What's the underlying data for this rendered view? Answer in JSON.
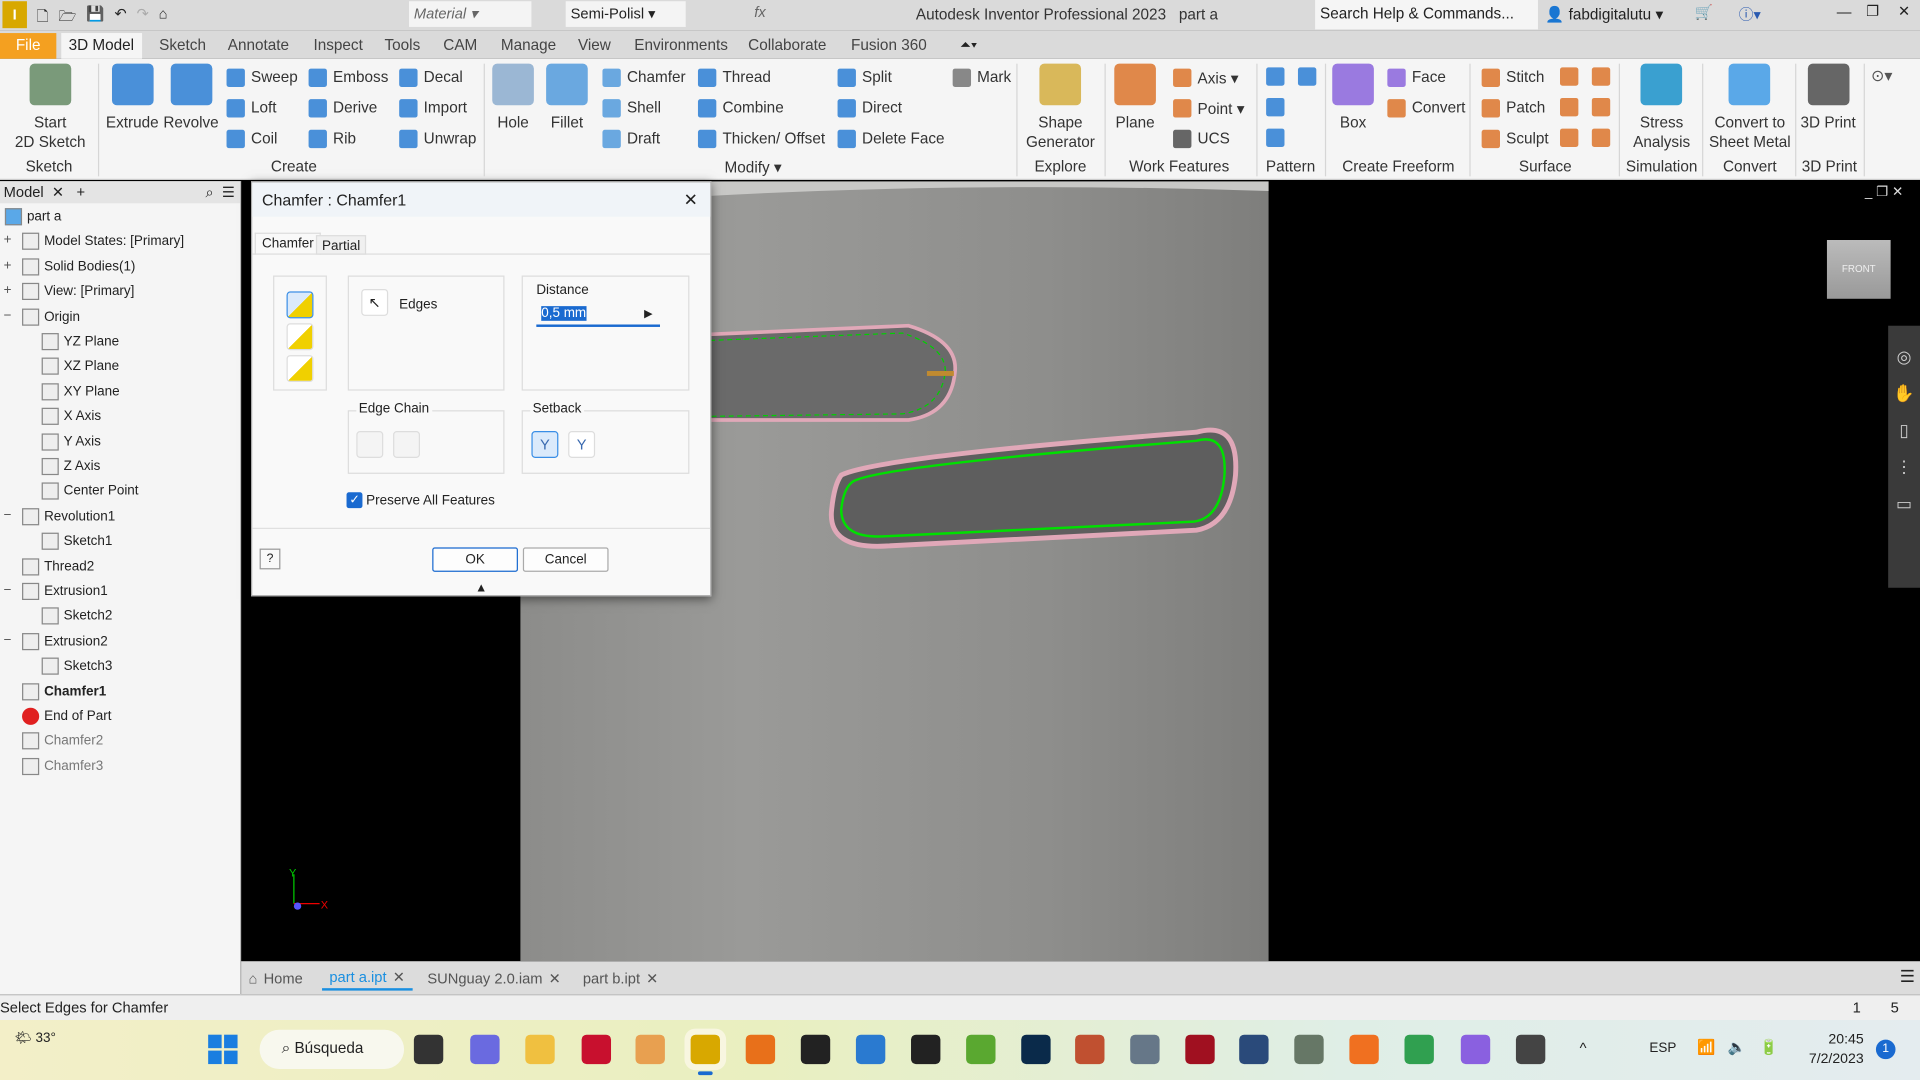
{
  "app": {
    "title": "Autodesk Inventor Professional 2023",
    "document": "part a",
    "search_placeholder": "Search Help & Commands...",
    "user": "fabdigitalutu",
    "material": "Material",
    "appearance": "Semi-Polisl"
  },
  "ribbon_tabs": [
    "File",
    "3D Model",
    "Sketch",
    "Annotate",
    "Inspect",
    "Tools",
    "CAM",
    "Manage",
    "View",
    "Environments",
    "Collaborate",
    "Fusion 360"
  ],
  "ribbon_groups": [
    "Sketch",
    "Create",
    "Modify ▾",
    "Explore",
    "Work Features",
    "Pattern",
    "Create Freeform",
    "Surface",
    "Simulation",
    "Convert",
    "3D Print"
  ],
  "ribbon_large": [
    {
      "label": "Start\n2D Sketch",
      "color": "#7a9a7a"
    },
    {
      "label": "Extrude",
      "color": "#4a90d9"
    },
    {
      "label": "Revolve",
      "color": "#4a90d9"
    },
    {
      "label": "Hole",
      "color": "#9bb7d4"
    },
    {
      "label": "Fillet",
      "color": "#6aa8e0"
    },
    {
      "label": "Shape\nGenerator",
      "color": "#d9b85a"
    },
    {
      "label": "Plane",
      "color": "#e0884a"
    },
    {
      "label": "Box",
      "color": "#9a7ae0"
    },
    {
      "label": "Stress\nAnalysis",
      "color": "#3aa0d0"
    },
    {
      "label": "Convert to\nSheet Metal",
      "color": "#5aa8e8"
    },
    {
      "label": "3D Print",
      "color": "#666666"
    }
  ],
  "ribbon_small": [
    {
      "label": "Sweep",
      "color": "#4a90d9"
    },
    {
      "label": "Loft",
      "color": "#4a90d9"
    },
    {
      "label": "Coil",
      "color": "#4a90d9"
    },
    {
      "label": "Emboss",
      "color": "#4a90d9"
    },
    {
      "label": "Derive",
      "color": "#4a90d9"
    },
    {
      "label": "Rib",
      "color": "#4a90d9"
    },
    {
      "label": "Decal",
      "color": "#4a90d9"
    },
    {
      "label": "Import",
      "color": "#4a90d9"
    },
    {
      "label": "Unwrap",
      "color": "#4a90d9"
    },
    {
      "label": "Chamfer",
      "color": "#6aa8e0"
    },
    {
      "label": "Shell",
      "color": "#6aa8e0"
    },
    {
      "label": "Draft",
      "color": "#6aa8e0"
    },
    {
      "label": "Thread",
      "color": "#4a90d9"
    },
    {
      "label": "Combine",
      "color": "#4a90d9"
    },
    {
      "label": "Thicken/ Offset",
      "color": "#4a90d9"
    },
    {
      "label": "Split",
      "color": "#4a90d9"
    },
    {
      "label": "Direct",
      "color": "#4a90d9"
    },
    {
      "label": "Delete Face",
      "color": "#4a90d9"
    },
    {
      "label": "Mark",
      "color": "#888888"
    },
    {
      "label": "Axis ▾",
      "color": "#e0884a"
    },
    {
      "label": "Point ▾",
      "color": "#e0884a"
    },
    {
      "label": "UCS",
      "color": "#666666"
    },
    {
      "label": "Face",
      "color": "#9a7ae0"
    },
    {
      "label": "Convert",
      "color": "#e0884a"
    },
    {
      "label": "Stitch",
      "color": "#e0884a"
    },
    {
      "label": "Patch",
      "color": "#e0884a"
    },
    {
      "label": "Sculpt",
      "color": "#e0884a"
    }
  ],
  "browser": {
    "tab": "Model",
    "items": [
      {
        "label": "part a",
        "lvl": 0
      },
      {
        "label": "Model States: [Primary]",
        "lvl": 1,
        "pm": "+"
      },
      {
        "label": "Solid Bodies(1)",
        "lvl": 1,
        "pm": "+"
      },
      {
        "label": "View: [Primary]",
        "lvl": 1,
        "pm": "+"
      },
      {
        "label": "Origin",
        "lvl": 1,
        "pm": "−"
      },
      {
        "label": "YZ Plane",
        "lvl": 2
      },
      {
        "label": "XZ Plane",
        "lvl": 2
      },
      {
        "label": "XY Plane",
        "lvl": 2
      },
      {
        "label": "X Axis",
        "lvl": 2
      },
      {
        "label": "Y Axis",
        "lvl": 2
      },
      {
        "label": "Z Axis",
        "lvl": 2
      },
      {
        "label": "Center Point",
        "lvl": 2
      },
      {
        "label": "Revolution1",
        "lvl": 1,
        "pm": "−"
      },
      {
        "label": "Sketch1",
        "lvl": 2
      },
      {
        "label": "Thread2",
        "lvl": 1
      },
      {
        "label": "Extrusion1",
        "lvl": 1,
        "pm": "−"
      },
      {
        "label": "Sketch2",
        "lvl": 2
      },
      {
        "label": "Extrusion2",
        "lvl": 1,
        "pm": "−"
      },
      {
        "label": "Sketch3",
        "lvl": 2
      },
      {
        "label": "Chamfer1",
        "lvl": 1,
        "style": "bold"
      },
      {
        "label": "End of Part",
        "lvl": 1,
        "icon": "error"
      },
      {
        "label": "Chamfer2",
        "lvl": 1,
        "style": "dim"
      },
      {
        "label": "Chamfer3",
        "lvl": 1,
        "style": "dim"
      }
    ]
  },
  "dialog": {
    "title": "Chamfer : Chamfer1",
    "tabs": [
      "Chamfer",
      "Partial"
    ],
    "edges_label": "Edges",
    "distance_label": "Distance",
    "distance_value": "0,5 mm",
    "edge_chain_label": "Edge Chain",
    "setback_label": "Setback",
    "preserve_label": "Preserve All Features",
    "preserve_checked": true,
    "ok": "OK",
    "cancel": "Cancel"
  },
  "viewcube": {
    "face": "FRONT"
  },
  "triad": {
    "x": "X",
    "y": "Y"
  },
  "doc_tabs": [
    {
      "label": "Home"
    },
    {
      "label": "part a.ipt",
      "active": true
    },
    {
      "label": "SUNguay 2.0.iam"
    },
    {
      "label": "part b.ipt"
    }
  ],
  "status": {
    "message": "Select Edges for Chamfer",
    "count1": "1",
    "count2": "5"
  },
  "taskbar": {
    "weather": "33°",
    "search": "Búsqueda",
    "lang": "ESP",
    "time": "20:45",
    "date": "7/2/2023",
    "badge": "1",
    "apps": [
      {
        "color": "#333333"
      },
      {
        "color": "#6a6ae0"
      },
      {
        "color": "#f0c040"
      },
      {
        "color": "#c8102e"
      },
      {
        "color": "#e8a050"
      },
      {
        "color": "#d8a800",
        "active": true
      },
      {
        "color": "#e8701a"
      },
      {
        "color": "#222222"
      },
      {
        "color": "#2a7ad0"
      },
      {
        "color": "#222222"
      },
      {
        "color": "#5aa830"
      },
      {
        "color": "#0a2a4a"
      },
      {
        "color": "#c05030"
      },
      {
        "color": "#667788"
      },
      {
        "color": "#a01020"
      },
      {
        "color": "#2a4a7a"
      },
      {
        "color": "#667766"
      },
      {
        "color": "#f07020"
      },
      {
        "color": "#30a050"
      },
      {
        "color": "#8a60e0"
      },
      {
        "color": "#444444"
      }
    ]
  },
  "colors": {
    "accent": "#1a8fe0",
    "file_tab": "#f4a020",
    "selection": "#00e000",
    "highlight": "#e8a0b0"
  }
}
